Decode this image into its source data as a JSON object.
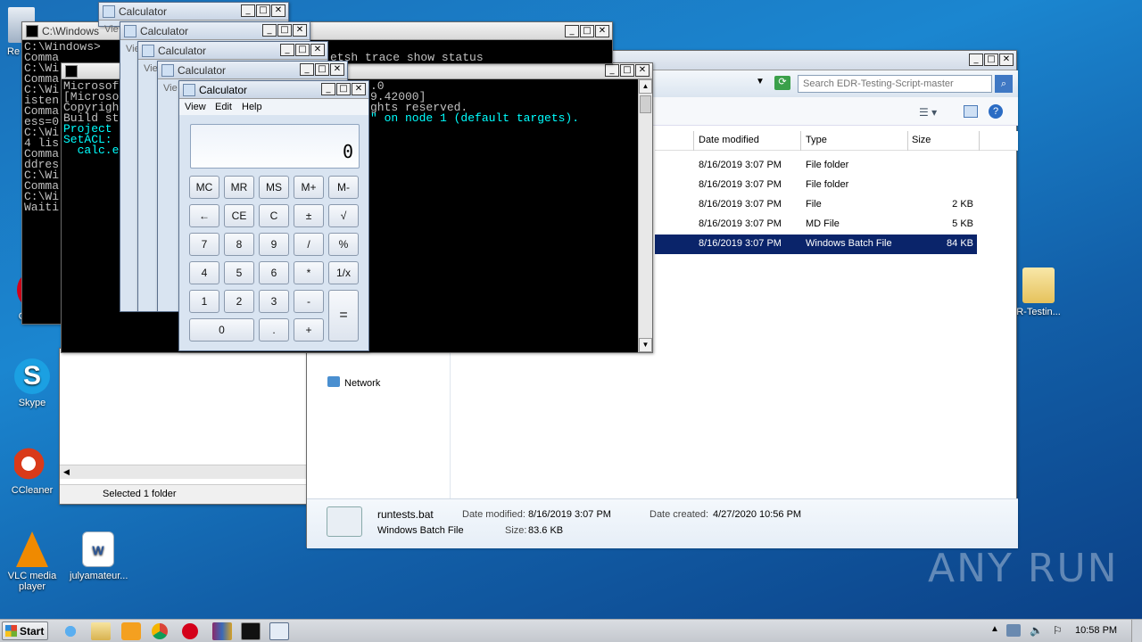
{
  "desktop": {
    "icons": [
      {
        "name": "recycle-bin-icon",
        "label": "Re"
      },
      {
        "name": "opera-icon",
        "label": "Opera"
      },
      {
        "name": "skype-icon",
        "label": "Skype"
      },
      {
        "name": "ccleaner-icon",
        "label": "CCleaner"
      },
      {
        "name": "vlc-icon",
        "label": "VLC media player"
      },
      {
        "name": "word-doc-icon",
        "label": "julyamateur..."
      },
      {
        "name": "folder-icon",
        "label": "R-Testin..."
      }
    ],
    "watermark": "ANY RUN"
  },
  "cmd_back": {
    "title": "C:\\Windows",
    "lines": [
      "C:\\Windows>",
      "Comma",
      "",
      "C:\\Wi",
      "",
      "Comma",
      "",
      "C:\\Wi",
      "isten",
      "",
      "Comma",
      "ess=0",
      "",
      "C:\\Wi",
      "4 lis",
      "Comma",
      "ddres",
      "",
      "C:\\Wi",
      "Comma",
      "",
      "C:\\Wi",
      "",
      "Waiti"
    ]
  },
  "cmd_main": {
    "title": "",
    "top_line": "etsh trace show status",
    "lines": [
      "Microsof",
      "[Microso",
      "Copyrigh",
      "",
      "Build st",
      "Project",
      "SetACL:",
      "  calc.e"
    ],
    "right_lines": [
      ".0",
      "9.42000]",
      "ghts reserved.",
      "",
      "",
      "\" on node 1 (default targets)."
    ]
  },
  "explorer": {
    "search_placeholder": "Search EDR-Testing-Script-master",
    "columns": [
      "Date modified",
      "Type",
      "Size"
    ],
    "rows": [
      {
        "date": "8/16/2019 3:07 PM",
        "type": "File folder",
        "size": ""
      },
      {
        "date": "8/16/2019 3:07 PM",
        "type": "File folder",
        "size": ""
      },
      {
        "date": "8/16/2019 3:07 PM",
        "type": "File",
        "size": "2 KB"
      },
      {
        "date": "8/16/2019 3:07 PM",
        "type": "MD File",
        "size": "5 KB"
      },
      {
        "date": "8/16/2019 3:07 PM",
        "type": "Windows Batch File",
        "size": "84 KB"
      }
    ],
    "nav_network": "Network",
    "details": {
      "filename": "runtests.bat",
      "filetype": "Windows Batch File",
      "date_modified_label": "Date modified:",
      "date_modified": "8/16/2019 3:07 PM",
      "date_created_label": "Date created:",
      "date_created": "4/27/2020 10:56 PM",
      "size_label": "Size:",
      "size": "83.6 KB"
    }
  },
  "explorer2": {
    "status": "Selected 1 folder"
  },
  "calculators": {
    "title": "Calculator",
    "menu": [
      "View",
      "Edit",
      "Help"
    ],
    "display": "0",
    "buttons": [
      [
        "MC",
        "MR",
        "MS",
        "M+",
        "M-"
      ],
      [
        "←",
        "CE",
        "C",
        "±",
        "√"
      ],
      [
        "7",
        "8",
        "9",
        "/",
        "%"
      ],
      [
        "4",
        "5",
        "6",
        "*",
        "1/x"
      ],
      [
        "1",
        "2",
        "3",
        "-",
        "="
      ],
      [
        "0",
        ".",
        "+"
      ]
    ],
    "stub_menu": "Vie"
  },
  "taskbar": {
    "start_label": "Start",
    "clock": "10:58 PM"
  },
  "colors": {
    "selection": "#0a246a",
    "console_cyan": "#00ffff"
  }
}
